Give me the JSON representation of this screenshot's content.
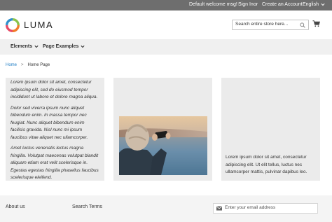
{
  "topbar": {
    "welcome": "Default welcome msg!",
    "sign_in": "Sign In",
    "or": "or",
    "create_account": "Create an Account",
    "language": "English"
  },
  "header": {
    "logo_text": "LUMA",
    "search_placeholder": "Search entire store here...",
    "icons": [
      "luma-logo-icon",
      "search-icon",
      "cart-icon",
      "chevron-down-icon"
    ]
  },
  "nav": {
    "items": [
      {
        "label": "Elements"
      },
      {
        "label": "Page Examples"
      }
    ]
  },
  "breadcrumbs": {
    "home": "Home",
    "separator": ">",
    "current": "Home Page"
  },
  "content": {
    "left_paragraphs": [
      "Lorem ipsum dolor sit amet, consectetur adipiscing elit, sed do eiusmod tempor incididunt ut labore et dolore magna aliqua.",
      "Dolor sed viverra ipsum nunc aliquet bibendum enim. In massa tempor nec feugiat. Nunc aliquet bibendum enim facilisis gravida. Nisl nunc mi ipsum faucibus vitae aliquet nec ullamcorper.",
      "Amet luctus venenatis lectus magna fringilla. Volutpat maecenas volutpat blandit aliquam etiam erat velit scelerisque in. Egestas egestas fringilla phasellus faucibus scelerisque eleifend."
    ],
    "right_paragraph": "Lorem ipsum dolor sit amet, consectetur adipiscing elit. Ut elit tellus, luctus nec ullamcorper mattis, pulvinar dapibus leo."
  },
  "footer": {
    "about": "About us",
    "search_terms": "Search Terms",
    "email_placeholder": "Enter your email address"
  },
  "colors": {
    "topbar_bg": "#6e6e6e",
    "link": "#1979c3",
    "panel_bg": "#ebebeb",
    "nav_bg": "#f0f0f0",
    "footer_bg": "#f4f4f4"
  }
}
